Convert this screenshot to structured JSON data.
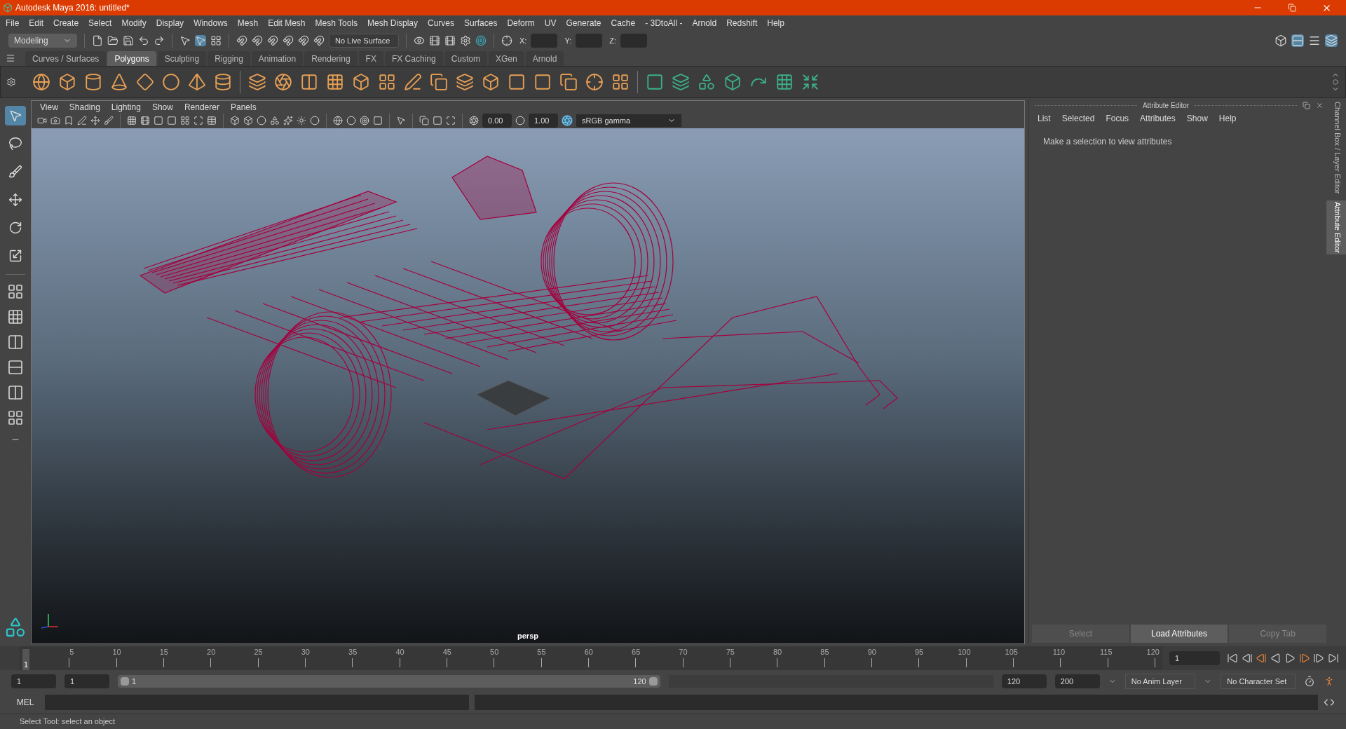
{
  "window": {
    "title": "Autodesk Maya 2016: untitled*"
  },
  "menu_bar": [
    "File",
    "Edit",
    "Create",
    "Select",
    "Modify",
    "Display",
    "Windows",
    "Mesh",
    "Edit Mesh",
    "Mesh Tools",
    "Mesh Display",
    "Curves",
    "Surfaces",
    "Deform",
    "UV",
    "Generate",
    "Cache",
    "- 3DtoAll -",
    "Arnold",
    "Redshift",
    "Help"
  ],
  "status_line": {
    "menu_set": "Modeling",
    "live_surface": "No Live Surface",
    "coordinates": [
      {
        "label": "X:"
      },
      {
        "label": "Y:"
      },
      {
        "label": "Z:"
      }
    ]
  },
  "shelf": {
    "tabs": [
      {
        "label": "Curves / Surfaces",
        "selected": false
      },
      {
        "label": "Polygons",
        "selected": true
      },
      {
        "label": "Sculpting",
        "selected": false
      },
      {
        "label": "Rigging",
        "selected": false
      },
      {
        "label": "Animation",
        "selected": false
      },
      {
        "label": "Rendering",
        "selected": false
      },
      {
        "label": "FX",
        "selected": false
      },
      {
        "label": "FX Caching",
        "selected": false
      },
      {
        "label": "Custom",
        "selected": false
      },
      {
        "label": "XGen",
        "selected": false
      },
      {
        "label": "Arnold",
        "selected": false
      }
    ]
  },
  "toolbox": {
    "tools": [
      {
        "selected": true
      },
      {
        "selected": false
      },
      {
        "selected": false
      },
      {
        "selected": false
      },
      {
        "selected": false
      },
      {
        "selected": false
      }
    ]
  },
  "viewport": {
    "menu": [
      "View",
      "Shading",
      "Lighting",
      "Show",
      "Renderer",
      "Panels"
    ],
    "exposure": "0.00",
    "gamma": "1.00",
    "color_space": "sRGB gamma",
    "camera": "persp"
  },
  "attribute_editor": {
    "title": "Attribute Editor",
    "menu": [
      "List",
      "Selected",
      "Focus",
      "Attributes",
      "Show",
      "Help"
    ],
    "message": "Make a selection to view attributes",
    "buttons": [
      {
        "label": "Select",
        "disabled": true
      },
      {
        "label": "Load Attributes",
        "disabled": false
      },
      {
        "label": "Copy Tab",
        "disabled": true
      }
    ]
  },
  "side_tabs": [
    {
      "label": "Channel Box / Layer Editor",
      "selected": false
    },
    {
      "label": "Attribute Editor",
      "selected": true
    }
  ],
  "time_slider": {
    "ticks": [
      "5",
      "10",
      "15",
      "20",
      "25",
      "30",
      "35",
      "40",
      "45",
      "50",
      "55",
      "60",
      "65",
      "70",
      "75",
      "80",
      "85",
      "90",
      "95",
      "100",
      "105",
      "110",
      "115",
      "120"
    ],
    "current_frame": "1",
    "level": 0,
    "frame_field": "1"
  },
  "range_slider": {
    "animation_start": "1",
    "playback_start": "1",
    "range_start": "1",
    "range_end": "120",
    "level": 1,
    "playback_end": "120",
    "animation_end": "200",
    "anim_layer": "No Anim Layer",
    "character_set": "No Character Set"
  },
  "command_line": {
    "label": "MEL"
  },
  "help_line": "Select Tool: select an object"
}
